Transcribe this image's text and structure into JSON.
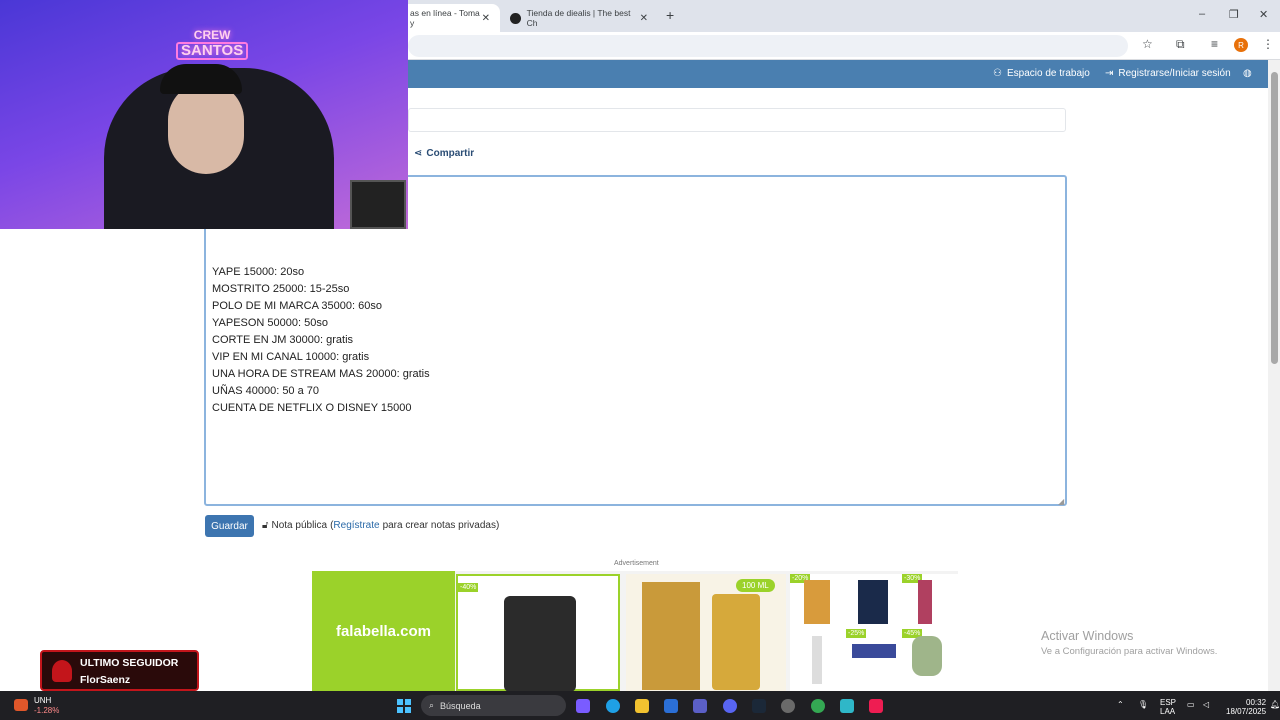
{
  "browser": {
    "tabs": [
      {
        "title": "as en línea - Toma y",
        "active": true
      },
      {
        "title": "Tienda de diealis | The best Ch",
        "active": false
      }
    ],
    "window_controls": {
      "minimize": "–",
      "restore": "❐",
      "close": "✕"
    }
  },
  "site_header": {
    "workspace": "Espacio de trabajo",
    "login": "Registrarse/Iniciar sesión"
  },
  "page": {
    "share": "Compartir",
    "note_lines": [
      "YAPE 15000: 20so",
      "MOSTRITO 25000: 15-25so",
      "POLO DE MI MARCA 35000: 60so",
      "YAPESON 50000: 50so",
      "CORTE EN JM 30000: gratis",
      "VIP EN MI CANAL 10000: gratis",
      "UNA HORA DE STREAM MAS 20000: gratis",
      "UÑAS 40000: 50 a 70",
      "CUENTA DE NETFLIX O DISNEY 15000"
    ],
    "save_button": "Guardar",
    "public_note": "Nota pública",
    "register_link": "Regístrate",
    "private_text": "para crear notas privadas)",
    "open_paren": "("
  },
  "ad": {
    "label": "Advertisement",
    "brand": "falabella.com",
    "badges": [
      "-40%",
      "100 ML",
      "-20%",
      "-30%",
      "-25%",
      "-45%"
    ]
  },
  "webcam": {
    "sign_top": "CREW",
    "sign_bottom": "SANTOS"
  },
  "follower": {
    "title": "ULTIMO SEGUIDOR",
    "name": "FlorSaenz"
  },
  "watermark": {
    "line1": "Activar Windows",
    "line2": "Ve a Configuración para activar Windows."
  },
  "taskbar": {
    "stock_symbol": "UNH",
    "stock_change": "-1.28%",
    "search_placeholder": "Búsqueda",
    "lang1": "ESP",
    "lang2": "LAA",
    "time": "00:32",
    "date": "18/07/2025"
  },
  "colors": {
    "header_blue": "#4a7fb0",
    "save_blue": "#3d75b0",
    "falabella_green": "#9bd22a",
    "follower_red": "#c3151b"
  }
}
